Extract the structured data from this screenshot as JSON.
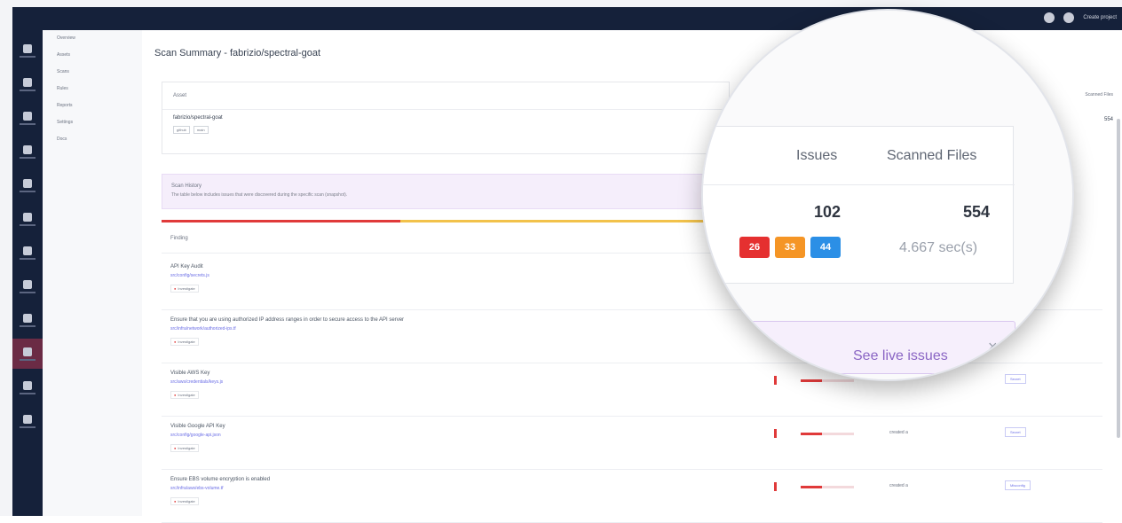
{
  "topbar": {
    "user_label": "Create project"
  },
  "rail": {
    "items": [
      {
        "label": "Overview",
        "icon": "grid-icon"
      },
      {
        "label": "Assets",
        "icon": "server-icon"
      },
      {
        "label": "Alerts",
        "icon": "shield-icon"
      },
      {
        "label": "Container",
        "icon": "box-icon"
      },
      {
        "label": "Network",
        "icon": "network-icon"
      },
      {
        "label": "API",
        "icon": "api-icon"
      },
      {
        "label": "Scan",
        "icon": "scan-icon"
      },
      {
        "label": "Runtime",
        "icon": "runtime-icon"
      },
      {
        "label": "Integrations",
        "icon": "plug-icon"
      },
      {
        "label": "Secrets",
        "icon": "secret-icon"
      },
      {
        "label": "Settings",
        "icon": "gear-icon"
      },
      {
        "label": "Account",
        "icon": "user-icon"
      }
    ],
    "active_index": 9
  },
  "subnav": [
    "Overview",
    "Assets",
    "Scans",
    "Rules",
    "Reports",
    "Settings",
    "Docs"
  ],
  "page": {
    "title": "Scan Summary - fabrizio/spectral-goat"
  },
  "asset_card": {
    "header": "Asset",
    "repo": "fabrizio/spectral-goat",
    "chips": [
      "github",
      "main"
    ]
  },
  "history_banner": {
    "title": "Scan History",
    "text": "The table below includes issues that were discovered during the specific scan (snapshot)."
  },
  "findings_header": "Finding",
  "findings": [
    {
      "name": "API Key Audit",
      "link": "src/config/secrets.js",
      "status": "Investigate",
      "stat": "",
      "tag": ""
    },
    {
      "name": "Ensure that you are using authorized IP address ranges in order to secure access to the API server",
      "link": "src/infra/network/authorized-ips.tf",
      "status": "Investigate",
      "stat": "",
      "tag": ""
    },
    {
      "name": "Visible AWS Key",
      "link": "src/aws/credentials/keys.js",
      "status": "Investigate",
      "stat": "",
      "tag": "Secret"
    },
    {
      "name": "Visible Google API Key",
      "link": "src/config/google-api.json",
      "status": "Investigate",
      "stat": "created a",
      "tag": "Secret"
    },
    {
      "name": "Ensure EBS volume encryption is enabled",
      "link": "src/infra/aws/ebs-volume.tf",
      "status": "Investigate",
      "stat": "created a",
      "tag": "Misconfig"
    }
  ],
  "right_column": {
    "header": "Scanned Files",
    "value": "554"
  },
  "magnifier": {
    "issues_header": "Issues",
    "files_header": "Scanned Files",
    "issues_value": "102",
    "files_value": "554",
    "badges": [
      {
        "value": "26",
        "color": "#e53030"
      },
      {
        "value": "33",
        "color": "#f59525"
      },
      {
        "value": "44",
        "color": "#2b8fe6"
      }
    ],
    "duration": "4.667 sec(s)",
    "live_link": "See live issues",
    "close": "×"
  }
}
